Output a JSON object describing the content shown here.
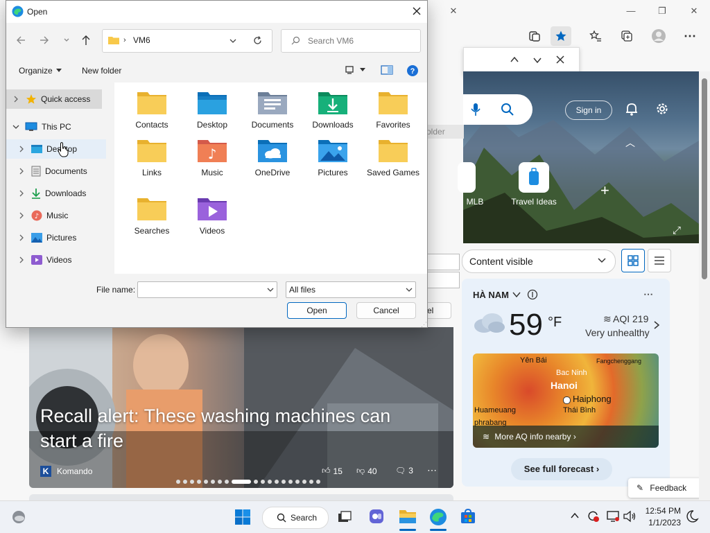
{
  "dialog": {
    "title": "Open",
    "address": {
      "folder": "VM6"
    },
    "search_placeholder": "Search VM6",
    "commands": {
      "organize": "Organize",
      "new_folder": "New folder"
    },
    "nav": [
      {
        "label": "Quick access"
      },
      {
        "label": "This PC"
      },
      {
        "label": "Desktop"
      },
      {
        "label": "Documents"
      },
      {
        "label": "Downloads"
      },
      {
        "label": "Music"
      },
      {
        "label": "Pictures"
      },
      {
        "label": "Videos"
      }
    ],
    "files": [
      {
        "label": "Contacts",
        "icon": "folder-icon"
      },
      {
        "label": "Desktop",
        "icon": "desktop-folder-icon"
      },
      {
        "label": "Documents",
        "icon": "documents-folder-icon"
      },
      {
        "label": "Downloads",
        "icon": "downloads-folder-icon"
      },
      {
        "label": "Favorites",
        "icon": "folder-icon"
      },
      {
        "label": "Links",
        "icon": "folder-icon"
      },
      {
        "label": "Music",
        "icon": "music-folder-icon"
      },
      {
        "label": "OneDrive",
        "icon": "onedrive-folder-icon"
      },
      {
        "label": "Pictures",
        "icon": "pictures-folder-icon"
      },
      {
        "label": "Saved Games",
        "icon": "folder-icon"
      },
      {
        "label": "Searches",
        "icon": "folder-icon"
      },
      {
        "label": "Videos",
        "icon": "videos-folder-icon"
      }
    ],
    "file_name_label": "File name:",
    "file_name_value": "",
    "file_type": "All files",
    "open_button": "Open",
    "cancel_button": "Cancel"
  },
  "browser": {
    "sign_in": "Sign in",
    "tiles": [
      "MLB",
      "Travel Ideas"
    ],
    "content_visible": "Content visible",
    "behind_dialog": {
      "folder_fragment": "older",
      "cancel_fragment": "el"
    },
    "news": {
      "title": "Recall alert: These washing machines can start a fire",
      "source": "Komando",
      "likes": "15",
      "dislikes": "40",
      "comments": "3"
    },
    "weather": {
      "location": "HÀ NAM",
      "temp": "59",
      "unit": "°F",
      "aqi": "AQI 219",
      "aqi_status": "Very unhealthy",
      "map_cities": [
        "Yên Bái",
        "Fangchenggang",
        "Bac Ninh",
        "Hanoi",
        "Haiphong",
        "Huameuang",
        "Thái Bình",
        "phrabang"
      ],
      "map_link": "More AQ info nearby",
      "forecast_button": "See full forecast"
    },
    "feedback": "Feedback"
  },
  "taskbar": {
    "search": "Search",
    "time": "12:54 PM",
    "date": "1/1/2023"
  },
  "colors": {
    "accent": "#0067c0",
    "folder_yellow": "#f8c94a",
    "edge_blue": "#1d8ce0"
  }
}
